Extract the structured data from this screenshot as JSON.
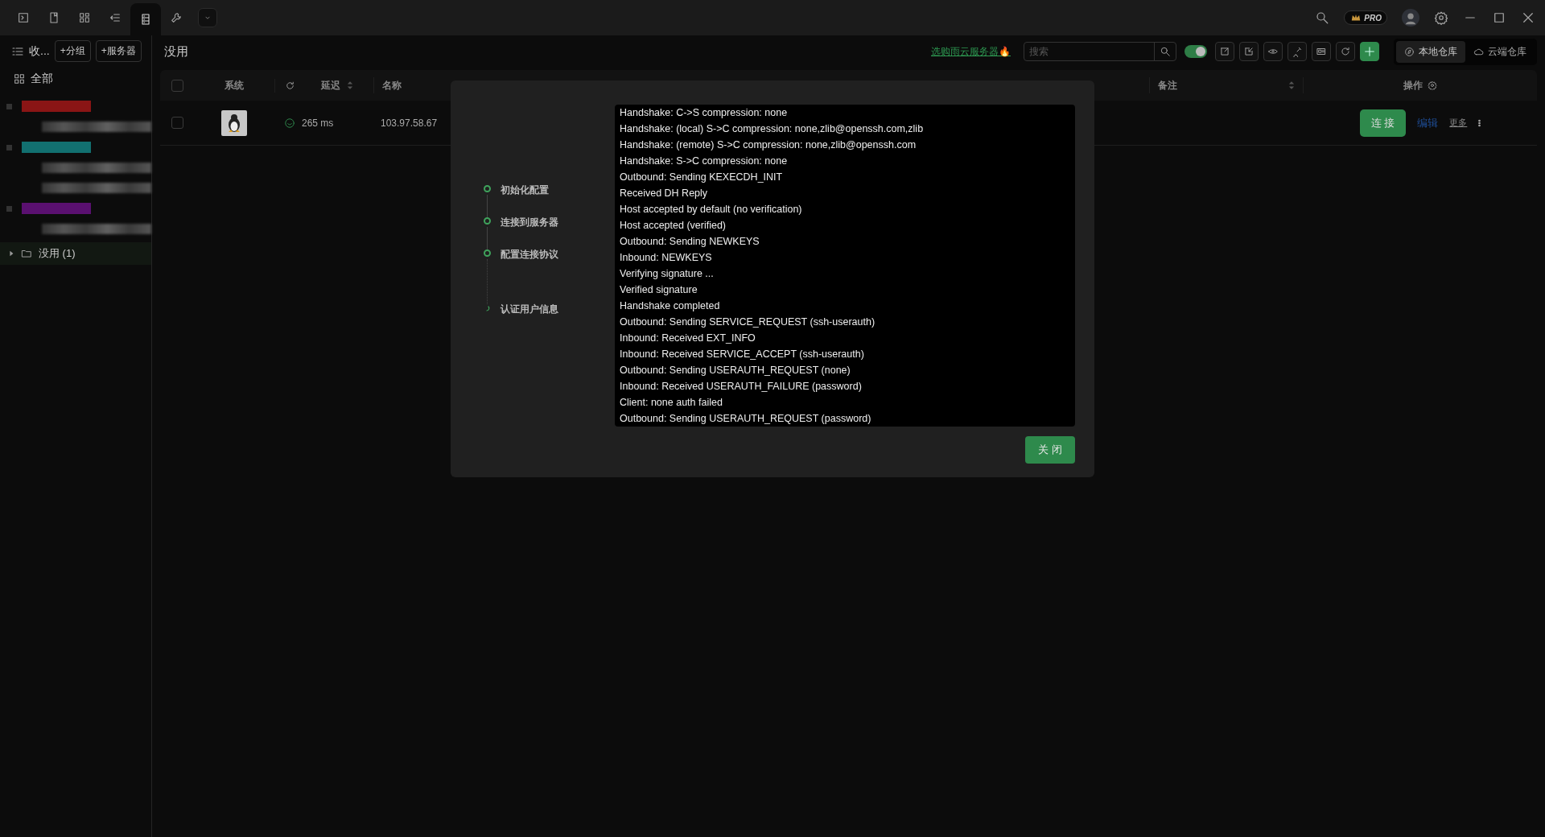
{
  "toolbar_tabs": [
    {
      "selected": false
    },
    {
      "selected": false
    },
    {
      "selected": false
    },
    {
      "selected": false
    },
    {
      "selected": true
    },
    {
      "selected": false
    },
    {
      "selected": false
    }
  ],
  "top_right": {
    "badge": "PRO"
  },
  "sidebar": {
    "collapse_label": "收...",
    "buttons": [
      "+分组",
      "+服务器"
    ],
    "all_label": "全部",
    "redacted_groups": [
      {
        "color": "#8a1515",
        "children": [
          {
            "kind": "redacted"
          }
        ]
      },
      {
        "color": "#127070",
        "children": [
          {
            "kind": "redacted"
          },
          {
            "kind": "redacted"
          }
        ]
      },
      {
        "color": "#5a1070",
        "children": [
          {
            "kind": "redacted"
          }
        ]
      }
    ],
    "folders": [
      {
        "label": "没用 (1)",
        "selected": true,
        "expanded": false
      }
    ]
  },
  "main": {
    "title": "没用",
    "promo_link": "选购雨云服务器🔥",
    "search": {
      "placeholder": "搜索"
    },
    "toggle": {
      "on": true
    },
    "repos": [
      {
        "label": "本地仓库",
        "selected": true
      },
      {
        "label": "云端仓库",
        "selected": false
      }
    ]
  },
  "table": {
    "select_all": {
      "checked": false
    },
    "columns": [
      "系统",
      "延迟",
      "名称",
      "备注",
      "操作"
    ],
    "rows": [
      {
        "checked": false,
        "latency": "265 ms",
        "name": "103.97.58.67",
        "actions": [
          "连 接",
          "编辑",
          "更多"
        ]
      }
    ]
  },
  "dialog": {
    "steps": [
      {
        "label": "初始化配置",
        "done": true
      },
      {
        "label": "连接到服务器",
        "done": true
      },
      {
        "label": "配置连接协议",
        "done": true
      },
      {
        "label": "认证用户信息",
        "done": false
      }
    ],
    "log": [
      "Handshake: C->S compression: none",
      "Handshake: (local) S->C compression: none,zlib@openssh.com,zlib",
      "Handshake: (remote) S->C compression: none,zlib@openssh.com",
      "Handshake: S->C compression: none",
      "Outbound: Sending KEXECDH_INIT",
      "Received DH Reply",
      "Host accepted by default (no verification)",
      "Host accepted (verified)",
      "Outbound: Sending NEWKEYS",
      "Inbound: NEWKEYS",
      "Verifying signature ...",
      "Verified signature",
      "Handshake completed",
      "Outbound: Sending SERVICE_REQUEST (ssh-userauth)",
      "Inbound: Received EXT_INFO",
      "Inbound: Received SERVICE_ACCEPT (ssh-userauth)",
      "Outbound: Sending USERAUTH_REQUEST (none)",
      "Inbound: Received USERAUTH_FAILURE (password)",
      "Client: none auth failed",
      "Outbound: Sending USERAUTH_REQUEST (password)"
    ],
    "close_button": "关 闭"
  }
}
